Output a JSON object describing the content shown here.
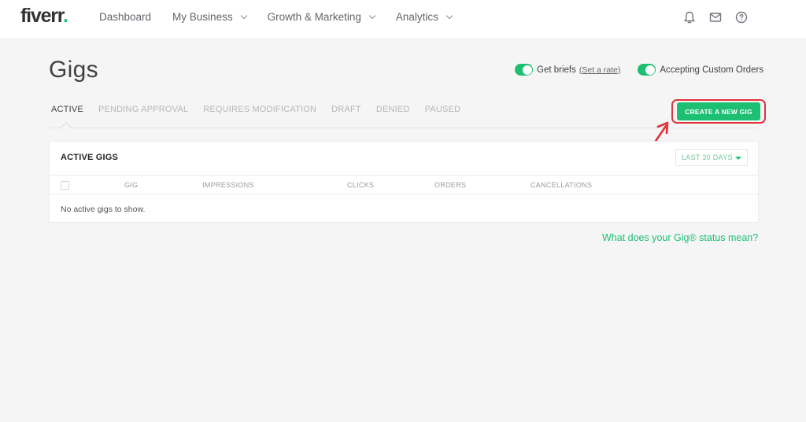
{
  "header": {
    "logo_text": "fiverr",
    "logo_dot": ".",
    "nav": [
      {
        "label": "Dashboard",
        "has_dropdown": false
      },
      {
        "label": "My Business",
        "has_dropdown": true
      },
      {
        "label": "Growth & Marketing",
        "has_dropdown": true
      },
      {
        "label": "Analytics",
        "has_dropdown": true
      }
    ],
    "icons": [
      "bell-icon",
      "mail-icon",
      "help-icon"
    ]
  },
  "page": {
    "title": "Gigs",
    "toggles": [
      {
        "label": "Get briefs",
        "link": "(Set a rate)",
        "on": true
      },
      {
        "label": "Accepting Custom Orders",
        "on": true
      }
    ],
    "tabs": [
      {
        "label": "ACTIVE",
        "active": true
      },
      {
        "label": "PENDING APPROVAL",
        "active": false
      },
      {
        "label": "REQUIRES MODIFICATION",
        "active": false
      },
      {
        "label": "DRAFT",
        "active": false
      },
      {
        "label": "DENIED",
        "active": false
      },
      {
        "label": "PAUSED",
        "active": false
      }
    ],
    "create_button": "CREATE A NEW GIG"
  },
  "card": {
    "title": "ACTIVE GIGS",
    "range_select": "LAST 30 DAYS",
    "columns": [
      "GIG",
      "IMPRESSIONS",
      "CLICKS",
      "ORDERS",
      "CANCELLATIONS"
    ],
    "empty_message": "No active gigs to show."
  },
  "help_link": "What does your Gig® status mean?",
  "colors": {
    "brand_green": "#1dbf73",
    "annotation_red": "#e0333a"
  }
}
